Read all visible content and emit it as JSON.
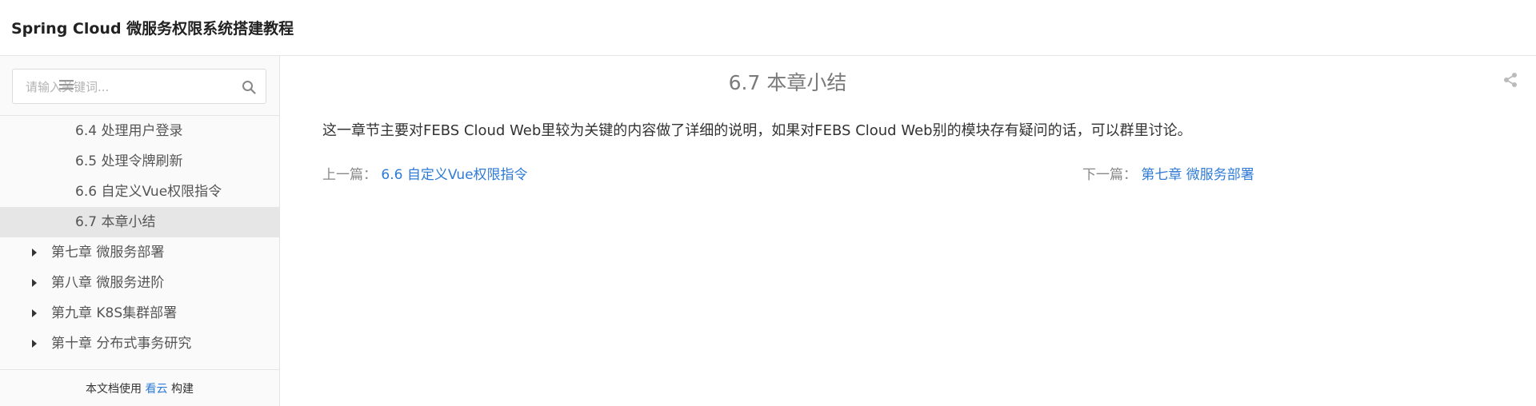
{
  "header": {
    "book_title": "Spring Cloud 微服务权限系统搭建教程"
  },
  "sidebar": {
    "search": {
      "placeholder": "请输入关键词...",
      "value": ""
    },
    "toc": [
      {
        "label": "6.4 处理用户登录",
        "level": "sub",
        "active": false
      },
      {
        "label": "6.5 处理令牌刷新",
        "level": "sub",
        "active": false
      },
      {
        "label": "6.6 自定义Vue权限指令",
        "level": "sub",
        "active": false
      },
      {
        "label": "6.7 本章小结",
        "level": "sub",
        "active": true
      },
      {
        "label": "第七章 微服务部署",
        "level": "chapter",
        "active": false
      },
      {
        "label": "第八章 微服务进阶",
        "level": "chapter",
        "active": false
      },
      {
        "label": "第九章 K8S集群部署",
        "level": "chapter",
        "active": false
      },
      {
        "label": "第十章 分布式事务研究",
        "level": "chapter",
        "active": false
      }
    ],
    "footer": {
      "prefix": "本文档使用",
      "link": "看云",
      "suffix": "构建"
    }
  },
  "content": {
    "title": "6.7 本章小结",
    "paragraph": "这一章节主要对FEBS Cloud Web里较为关键的内容做了详细的说明，如果对FEBS Cloud Web别的模块存有疑问的话，可以群里讨论。",
    "prev_label": "上一篇：",
    "prev_link": "6.6 自定义Vue权限指令",
    "next_label": "下一篇：",
    "next_link": "第七章 微服务部署"
  },
  "icons": {
    "search": "search-icon",
    "toc_toggle": "menu-icon",
    "share": "share-icon",
    "caret": "caret-right-icon"
  },
  "colors": {
    "link": "#2f7bd5",
    "active_item_bg": "#e6e6e6",
    "title_gray": "#7a7a7a"
  }
}
